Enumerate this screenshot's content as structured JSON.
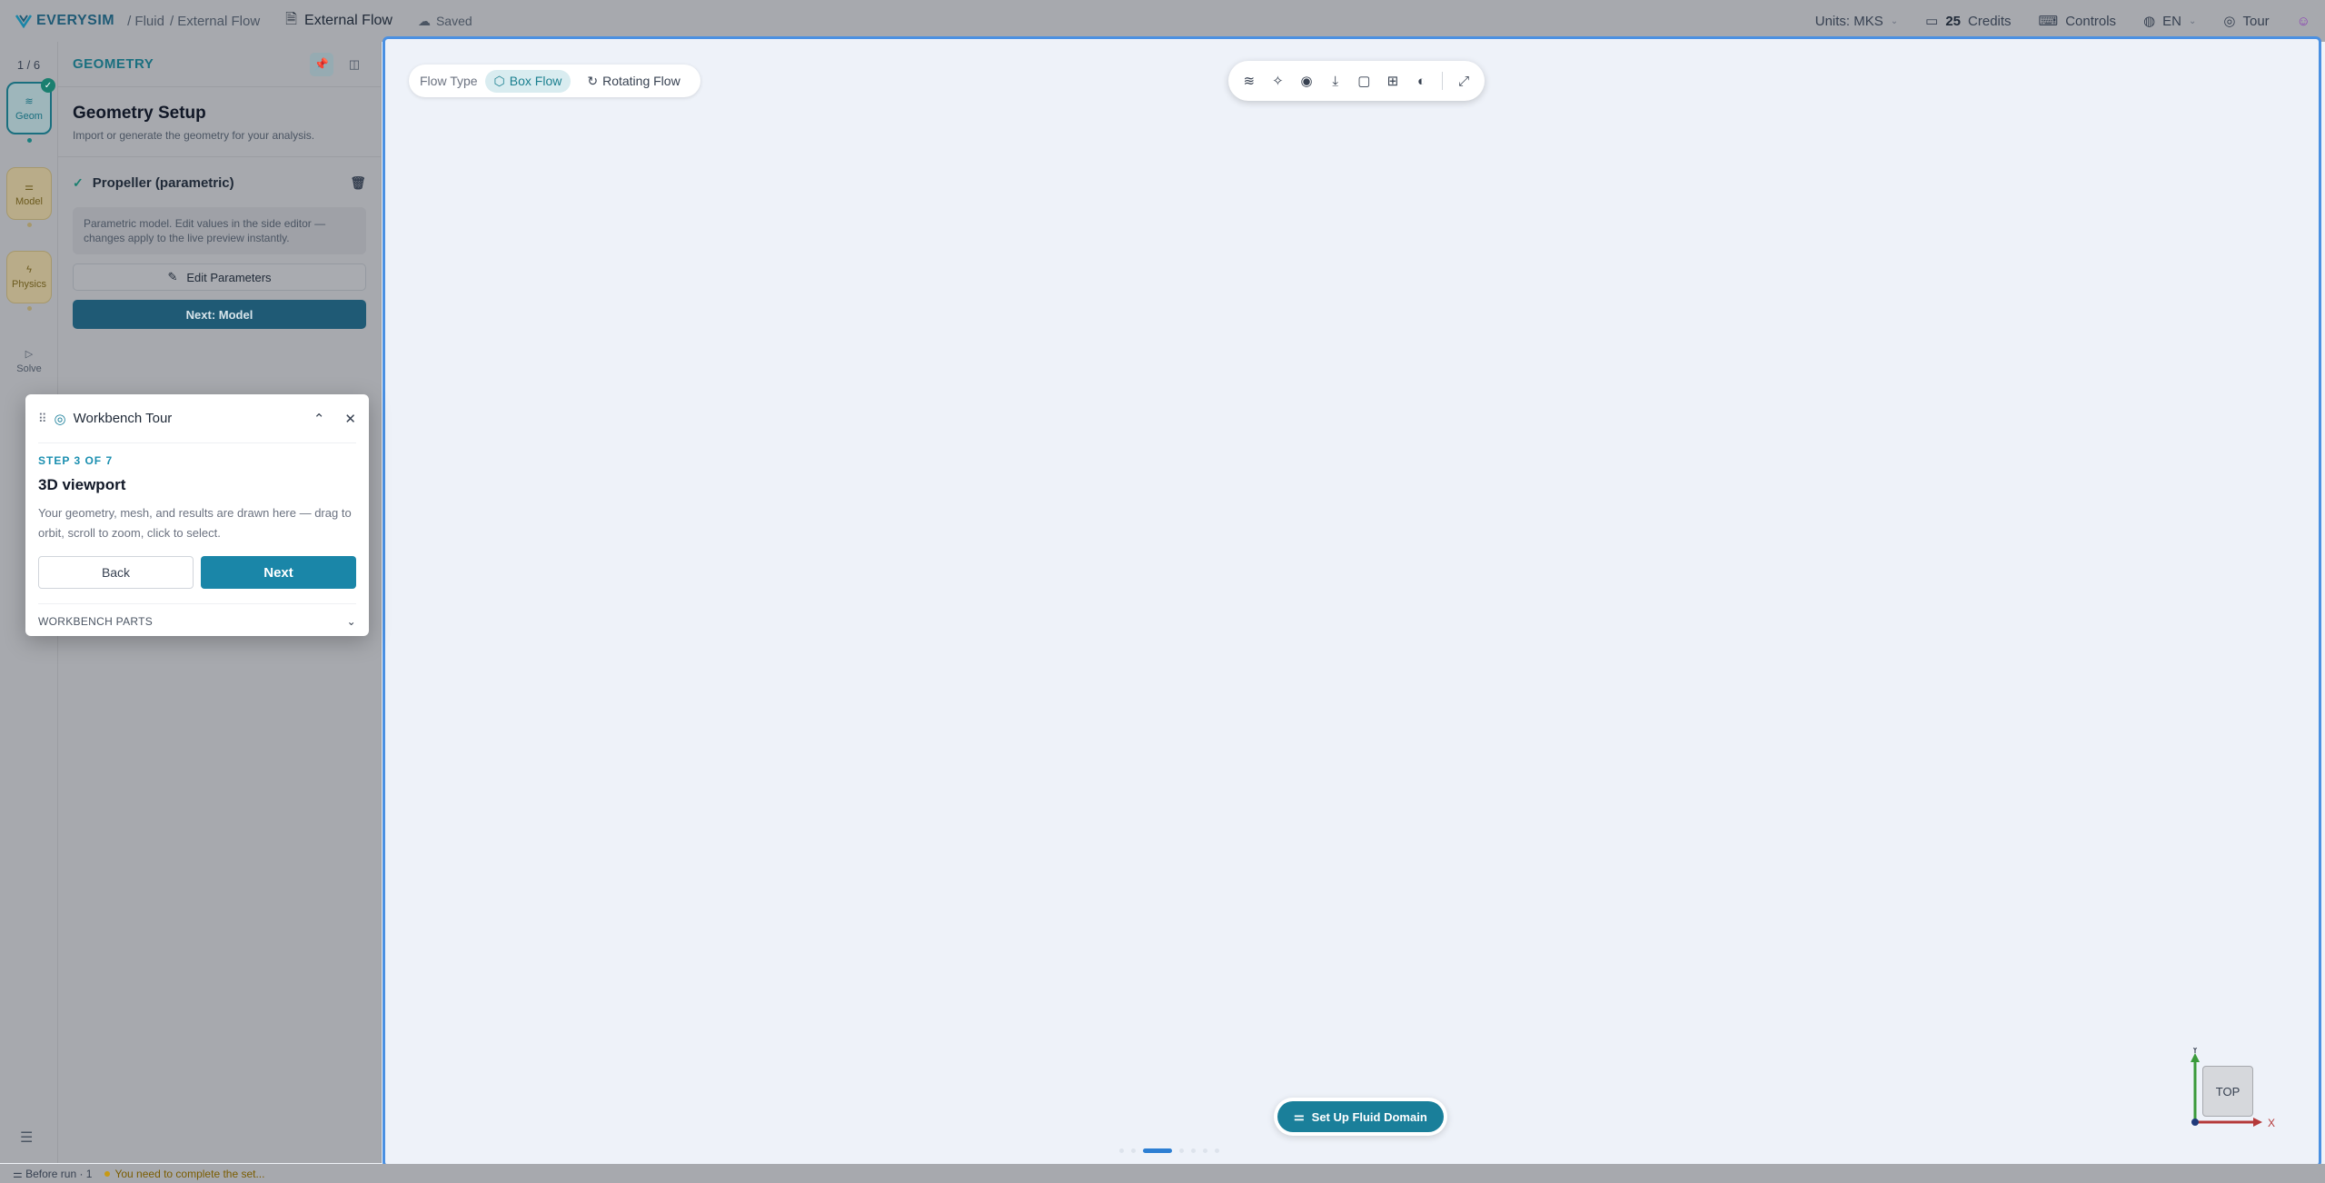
{
  "header": {
    "brand": "EVERYSIM",
    "crumbs": [
      "/ Fluid",
      "/ External Flow"
    ],
    "doc_title": "External Flow",
    "saved": "Saved",
    "units": "Units: MKS",
    "credits_count": "25",
    "credits_label": "Credits",
    "controls": "Controls",
    "language": "EN",
    "tour": "Tour"
  },
  "rail": {
    "counter": "1 / 6",
    "steps": [
      {
        "label": "Geom",
        "icon": "layers-icon"
      },
      {
        "label": "Model",
        "icon": "sliders-icon"
      },
      {
        "label": "Physics",
        "icon": "lightning-icon"
      },
      {
        "label": "Solve",
        "icon": "play-icon"
      }
    ]
  },
  "panel": {
    "title": "GEOMETRY",
    "section_title": "Geometry Setup",
    "section_sub": "Import or generate the geometry for your analysis.",
    "item_name": "Propeller (parametric)",
    "info": "Parametric model. Edit values in the side editor — changes apply to the live preview instantly.",
    "edit_button": "Edit Parameters",
    "next_button": "Next: Model"
  },
  "viewport": {
    "flow_type_label": "Flow Type",
    "flow_options": [
      "Box Flow",
      "Rotating Flow"
    ],
    "selected_flow": "Box Flow",
    "setup_button": "Set Up Fluid Domain",
    "cube_label": "TOP",
    "axis_y": "Y",
    "axis_x": "X"
  },
  "status": {
    "run": "Before run · 1",
    "warning": "You need to complete the set..."
  },
  "tour": {
    "title": "Workbench Tour",
    "step": "STEP 3 OF 7",
    "heading": "3D viewport",
    "body": "Your geometry, mesh, and results are drawn here — drag to orbit, scroll to zoom, click to select.",
    "back": "Back",
    "next": "Next",
    "footer": "WORKBENCH PARTS"
  },
  "colors": {
    "accent": "#1a86a8",
    "viewport_border": "#4a90e2",
    "dim_overlay": "#a7a9ae"
  }
}
